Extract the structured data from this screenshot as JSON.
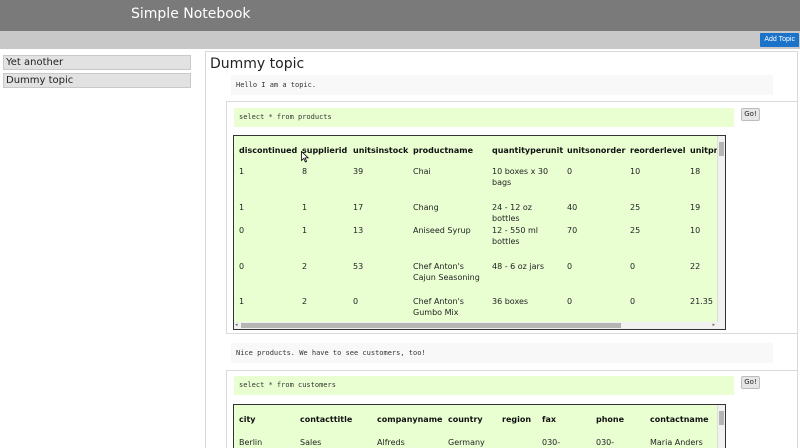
{
  "app": {
    "title": "Simple Notebook"
  },
  "toolbar": {
    "add_topic_label": "Add Topic"
  },
  "sidebar": {
    "items": [
      {
        "label": "Yet another"
      },
      {
        "label": "Dummy topic"
      }
    ]
  },
  "topic": {
    "title": "Dummy topic",
    "intro_note": "Hello I am a topic.",
    "cell1": {
      "query": "select * from products",
      "go_label": "Go!",
      "columns": [
        "discontinued",
        "supplierid",
        "unitsinstock",
        "productname",
        "quantityperunit",
        "unitsonorder",
        "reorderlevel",
        "unitpri"
      ],
      "rows": [
        [
          "1",
          "8",
          "39",
          "Chai",
          "10 boxes x 30 bags",
          "0",
          "10",
          "18"
        ],
        [
          "1",
          "1",
          "17",
          "Chang",
          "24 - 12 oz bottles",
          "40",
          "25",
          "19"
        ],
        [
          "0",
          "1",
          "13",
          "Aniseed Syrup",
          "12 - 550 ml bottles",
          "70",
          "25",
          "10"
        ],
        [
          "0",
          "2",
          "53",
          "Chef Anton's Cajun Seasoning",
          "48 - 6 oz jars",
          "0",
          "0",
          "22"
        ],
        [
          "1",
          "2",
          "0",
          "Chef Anton's Gumbo Mix",
          "36 boxes",
          "0",
          "0",
          "21.35"
        ]
      ]
    },
    "middle_note": "Nice products. We have to see customers, too!",
    "cell2": {
      "query": "select * from customers",
      "go_label": "Go!",
      "columns": [
        "city",
        "contacttitle",
        "companyname",
        "country",
        "region",
        "fax",
        "phone",
        "contactname"
      ],
      "rows": [
        [
          "Berlin",
          "Sales",
          "Alfreds",
          "Germany",
          "",
          "030-",
          "030-",
          "Maria Anders"
        ]
      ]
    }
  }
}
